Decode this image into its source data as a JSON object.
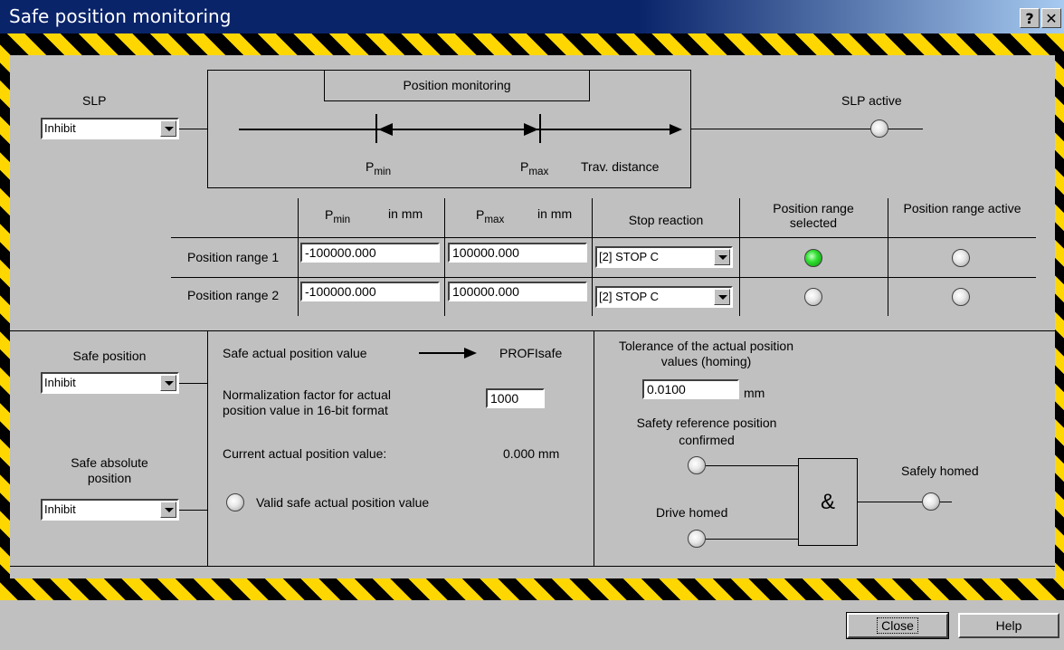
{
  "window": {
    "title": "Safe position monitoring",
    "help_glyph": "?",
    "close_glyph": "✕"
  },
  "slp": {
    "label": "SLP",
    "value": "Inhibit",
    "active_label": "SLP active"
  },
  "diagram": {
    "title": "Position monitoring",
    "pmin": "P",
    "pmin_sub": "min",
    "pmax": "P",
    "pmax_sub": "max",
    "distance": "Trav. distance"
  },
  "table": {
    "col_pmin": "P",
    "col_pmin_sub": "min",
    "col_pmin_unit": "in mm",
    "col_pmax": "P",
    "col_pmax_sub": "max",
    "col_pmax_unit": "in mm",
    "col_stop": "Stop reaction",
    "col_selected": "Position range selected",
    "col_active": "Position range active",
    "rows": [
      {
        "label": "Position range 1",
        "pmin": "-100000.000",
        "pmax": "100000.000",
        "stop": "[2] STOP C",
        "selected": true,
        "active": false
      },
      {
        "label": "Position range 2",
        "pmin": "-100000.000",
        "pmax": "100000.000",
        "stop": "[2] STOP C",
        "selected": false,
        "active": false
      }
    ]
  },
  "safe_position": {
    "label": "Safe position",
    "value": "Inhibit"
  },
  "safe_absolute": {
    "label": "Safe absolute position",
    "value": "Inhibit"
  },
  "middle": {
    "actual_label": "Safe actual position value",
    "profisafe": "PROFIsafe",
    "norm_label": "Normalization factor for actual position value in 16-bit format",
    "norm_value": "1000",
    "current_label": "Current actual position value:",
    "current_value": "0.000 mm",
    "valid_label": "Valid safe actual position value"
  },
  "right": {
    "tolerance_label": "Tolerance of the actual position values (homing)",
    "tolerance_value": "0.0100",
    "tolerance_unit": "mm",
    "ref_label": "Safety reference position confirmed",
    "drive_homed": "Drive homed",
    "and_symbol": "&",
    "safely_homed": "Safely homed"
  },
  "buttons": {
    "close": "Close",
    "help": "Help"
  }
}
